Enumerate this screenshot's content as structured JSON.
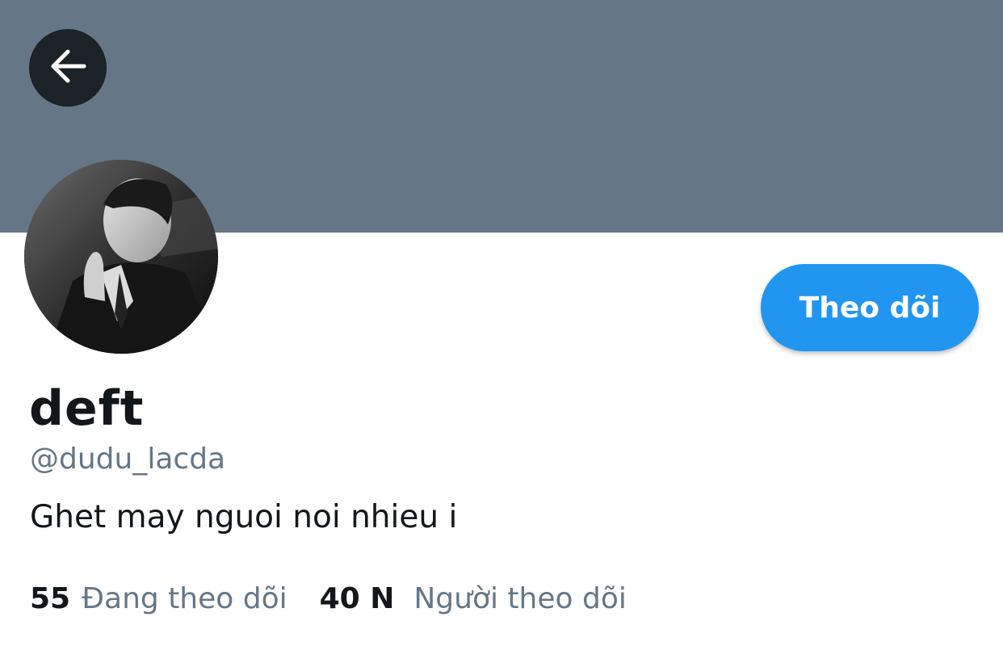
{
  "header": {
    "back_icon": "arrow-left-icon",
    "banner_color": "#657786"
  },
  "profile": {
    "display_name": "deft",
    "handle": "@dudu_lacda",
    "bio": "Ghet may nguoi noi nhieu i",
    "avatar": "profile-photo (black and white portrait)"
  },
  "actions": {
    "follow_label": "Theo dõi",
    "follow_color": "#2196f0"
  },
  "stats": {
    "following_count": "55",
    "following_label": "Đang theo dõi",
    "followers_count": "40 N",
    "followers_label": "Người theo dõi"
  }
}
